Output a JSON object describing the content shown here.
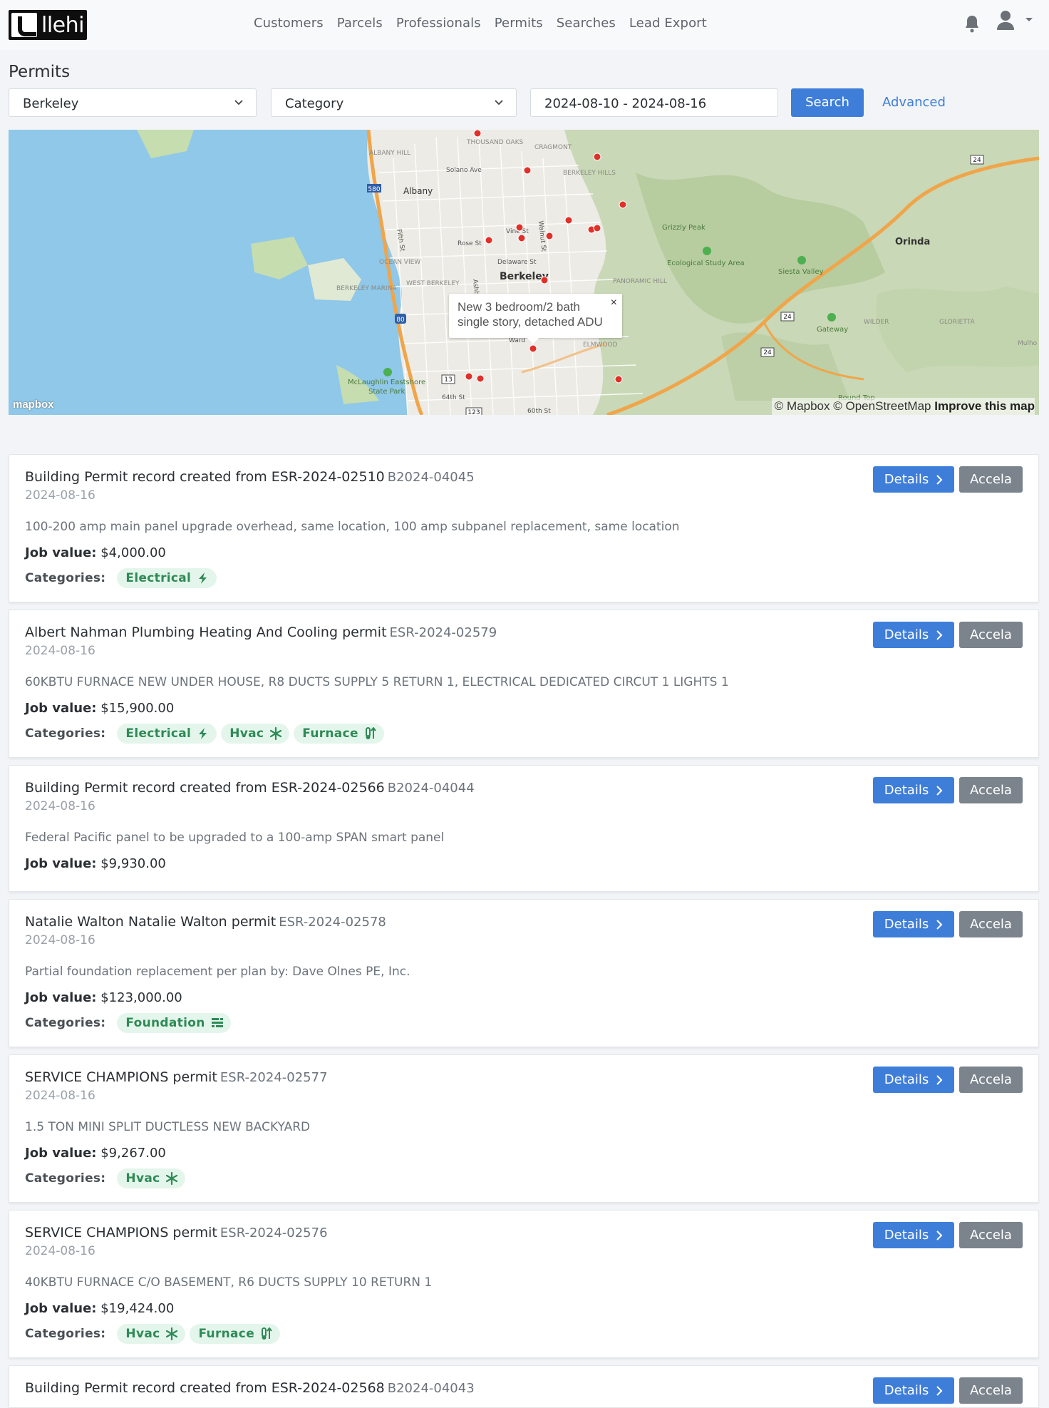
{
  "brand": {
    "logo_text": "llehi"
  },
  "nav": {
    "links": [
      "Customers",
      "Parcels",
      "Professionals",
      "Permits",
      "Searches",
      "Lead Export"
    ]
  },
  "page": {
    "title": "Permits"
  },
  "filters": {
    "city": "Berkeley",
    "category_placeholder": "Category",
    "date_range": "2024-08-10 - 2024-08-16",
    "search_label": "Search",
    "advanced_label": "Advanced"
  },
  "map": {
    "popup_text_line1": "New 3 bedroom/2 bath",
    "popup_text_line2": "single story, detached ADU",
    "popup_close": "×",
    "attribution_prefix": "© Mapbox © OpenStreetMap",
    "attribution_link": "Improve this map",
    "mapbox_logo": "mapbox",
    "labels": {
      "albany": "Albany",
      "berkeley": "Berkeley",
      "orinda": "Orinda",
      "albany_hill": "ALBANY HILL",
      "thousand_oaks": "THOUSAND OAKS",
      "cragmont": "CRAGMONT",
      "berkeley_hills": "BERKELEY HILLS",
      "solano_ave": "Solano Ave",
      "ocean_view": "OCEAN VIEW",
      "west_berkeley": "WEST BERKELEY",
      "berkeley_marina": "BERKELEY MARINA",
      "panoramic_hill": "PANORAMIC HILL",
      "elmwood": "ELMWOOD",
      "grizzly_peak": "Grizzly Peak",
      "ecological_study_area": "Ecological Study Area",
      "siesta_valley": "Siesta Valley",
      "gateway": "Gateway",
      "wilder": "WILDER",
      "glorietta": "GLORIETTA",
      "round_top": "Round Top",
      "mcLaughlin_1": "McLaughlin Eastshore",
      "mcLaughlin_2": "State Park",
      "fifth_st": "Fifth St",
      "rose_st": "Rose St",
      "vine_st": "Vine St",
      "walnut_st": "Walnut St",
      "delaware_st": "Delaware St",
      "ashby": "Ashby",
      "ward": "Ward",
      "st_64": "64th St",
      "st_60": "60th St",
      "mulho": "Mulho",
      "hw_580": "580",
      "hw_80": "80",
      "hw_24a": "24",
      "hw_24b": "24",
      "hw_24c": "24",
      "hw_13": "13",
      "hw_123": "123"
    }
  },
  "cards": [
    {
      "title": "Building Permit record created from ESR-2024-02510",
      "record": "B2024-04045",
      "date": "2024-08-16",
      "description": "100-200 amp main panel upgrade overhead, same location, 100 amp subpanel replacement, same location",
      "value_label": "Job value:",
      "value": "$4,000.00",
      "categories_label": "Categories:",
      "categories": [
        "Electrical"
      ],
      "details_label": "Details",
      "accela_label": "Accela"
    },
    {
      "title": "Albert Nahman Plumbing Heating And Cooling permit",
      "record": "ESR-2024-02579",
      "date": "2024-08-16",
      "description": "60KBTU FURNACE NEW UNDER HOUSE, R8 DUCTS SUPPLY 5 RETURN 1, ELECTRICAL DEDICATED CIRCUT 1 LIGHTS 1",
      "value_label": "Job value:",
      "value": "$15,900.00",
      "categories_label": "Categories:",
      "categories": [
        "Electrical",
        "Hvac",
        "Furnace"
      ],
      "details_label": "Details",
      "accela_label": "Accela"
    },
    {
      "title": "Building Permit record created from ESR-2024-02566",
      "record": "B2024-04044",
      "date": "2024-08-16",
      "description": "Federal Pacific panel to be upgraded to a 100-amp SPAN smart panel",
      "value_label": "Job value:",
      "value": "$9,930.00",
      "categories_label": "",
      "categories": [],
      "details_label": "Details",
      "accela_label": "Accela"
    },
    {
      "title": "Natalie Walton Natalie Walton permit",
      "record": "ESR-2024-02578",
      "date": "2024-08-16",
      "description": "Partial foundation replacement per plan by: Dave Olnes PE, Inc.",
      "value_label": "Job value:",
      "value": "$123,000.00",
      "categories_label": "Categories:",
      "categories": [
        "Foundation"
      ],
      "details_label": "Details",
      "accela_label": "Accela"
    },
    {
      "title": "SERVICE CHAMPIONS permit",
      "record": "ESR-2024-02577",
      "date": "2024-08-16",
      "description": "1.5 TON MINI SPLIT DUCTLESS NEW BACKYARD",
      "value_label": "Job value:",
      "value": "$9,267.00",
      "categories_label": "Categories:",
      "categories": [
        "Hvac"
      ],
      "details_label": "Details",
      "accela_label": "Accela"
    },
    {
      "title": "SERVICE CHAMPIONS permit",
      "record": "ESR-2024-02576",
      "date": "2024-08-16",
      "description": "40KBTU FURNACE C/O BASEMENT, R6 DUCTS SUPPLY 10 RETURN 1",
      "value_label": "Job value:",
      "value": "$19,424.00",
      "categories_label": "Categories:",
      "categories": [
        "Hvac",
        "Furnace"
      ],
      "details_label": "Details",
      "accela_label": "Accela"
    },
    {
      "title": "Building Permit record created from ESR-2024-02568",
      "record": "B2024-04043",
      "date": "",
      "description": "",
      "value_label": "",
      "value": "",
      "categories_label": "",
      "categories": [],
      "details_label": "Details",
      "accela_label": "Accela"
    }
  ],
  "colors": {
    "primary": "#3e7ed9",
    "secondary": "#7b838c",
    "badge_bg": "#e4f6ec",
    "badge_text": "#2f8a56",
    "marker": "#e0302a",
    "water": "#8fc8e8",
    "highway": "#f0a54a"
  },
  "icons": {
    "Electrical": "bolt-icon",
    "Hvac": "snowflake-icon",
    "Furnace": "thermometer-fire-icon",
    "Foundation": "foundation-icon"
  }
}
